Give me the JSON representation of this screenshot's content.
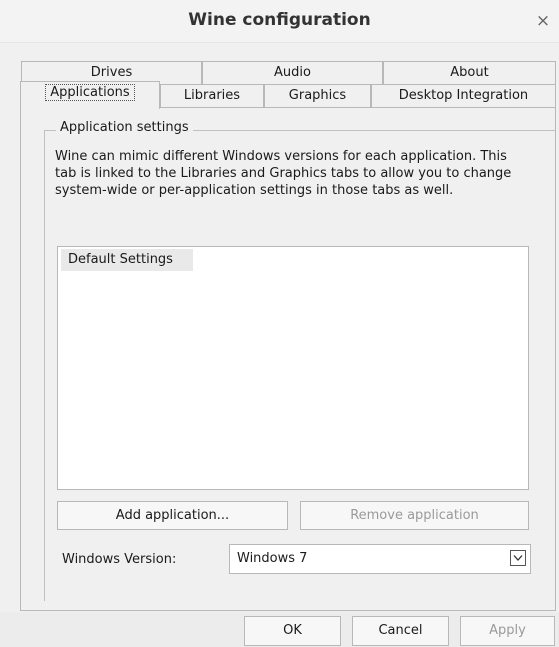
{
  "window": {
    "title": "Wine configuration",
    "close_glyph": "×",
    "close_icon": "close-icon"
  },
  "tabs": {
    "row1": [
      "Drives",
      "Audio",
      "About"
    ],
    "row2": [
      "Applications",
      "Libraries",
      "Graphics",
      "Desktop Integration"
    ],
    "active": "Applications"
  },
  "group": {
    "label": "Application settings",
    "description": "Wine can mimic different Windows versions for each application. This tab is linked to the Libraries and Graphics tabs to allow you to change system-wide or per-application settings in those tabs as well."
  },
  "applications_list": {
    "items": [
      "Default Settings"
    ],
    "selected": "Default Settings"
  },
  "buttons": {
    "add": "Add application...",
    "remove": "Remove application",
    "ok": "OK",
    "cancel": "Cancel",
    "apply": "Apply"
  },
  "windows_version": {
    "label": "Windows Version:",
    "value": "Windows 7",
    "dropdown_icon": "chevron-down-icon"
  }
}
